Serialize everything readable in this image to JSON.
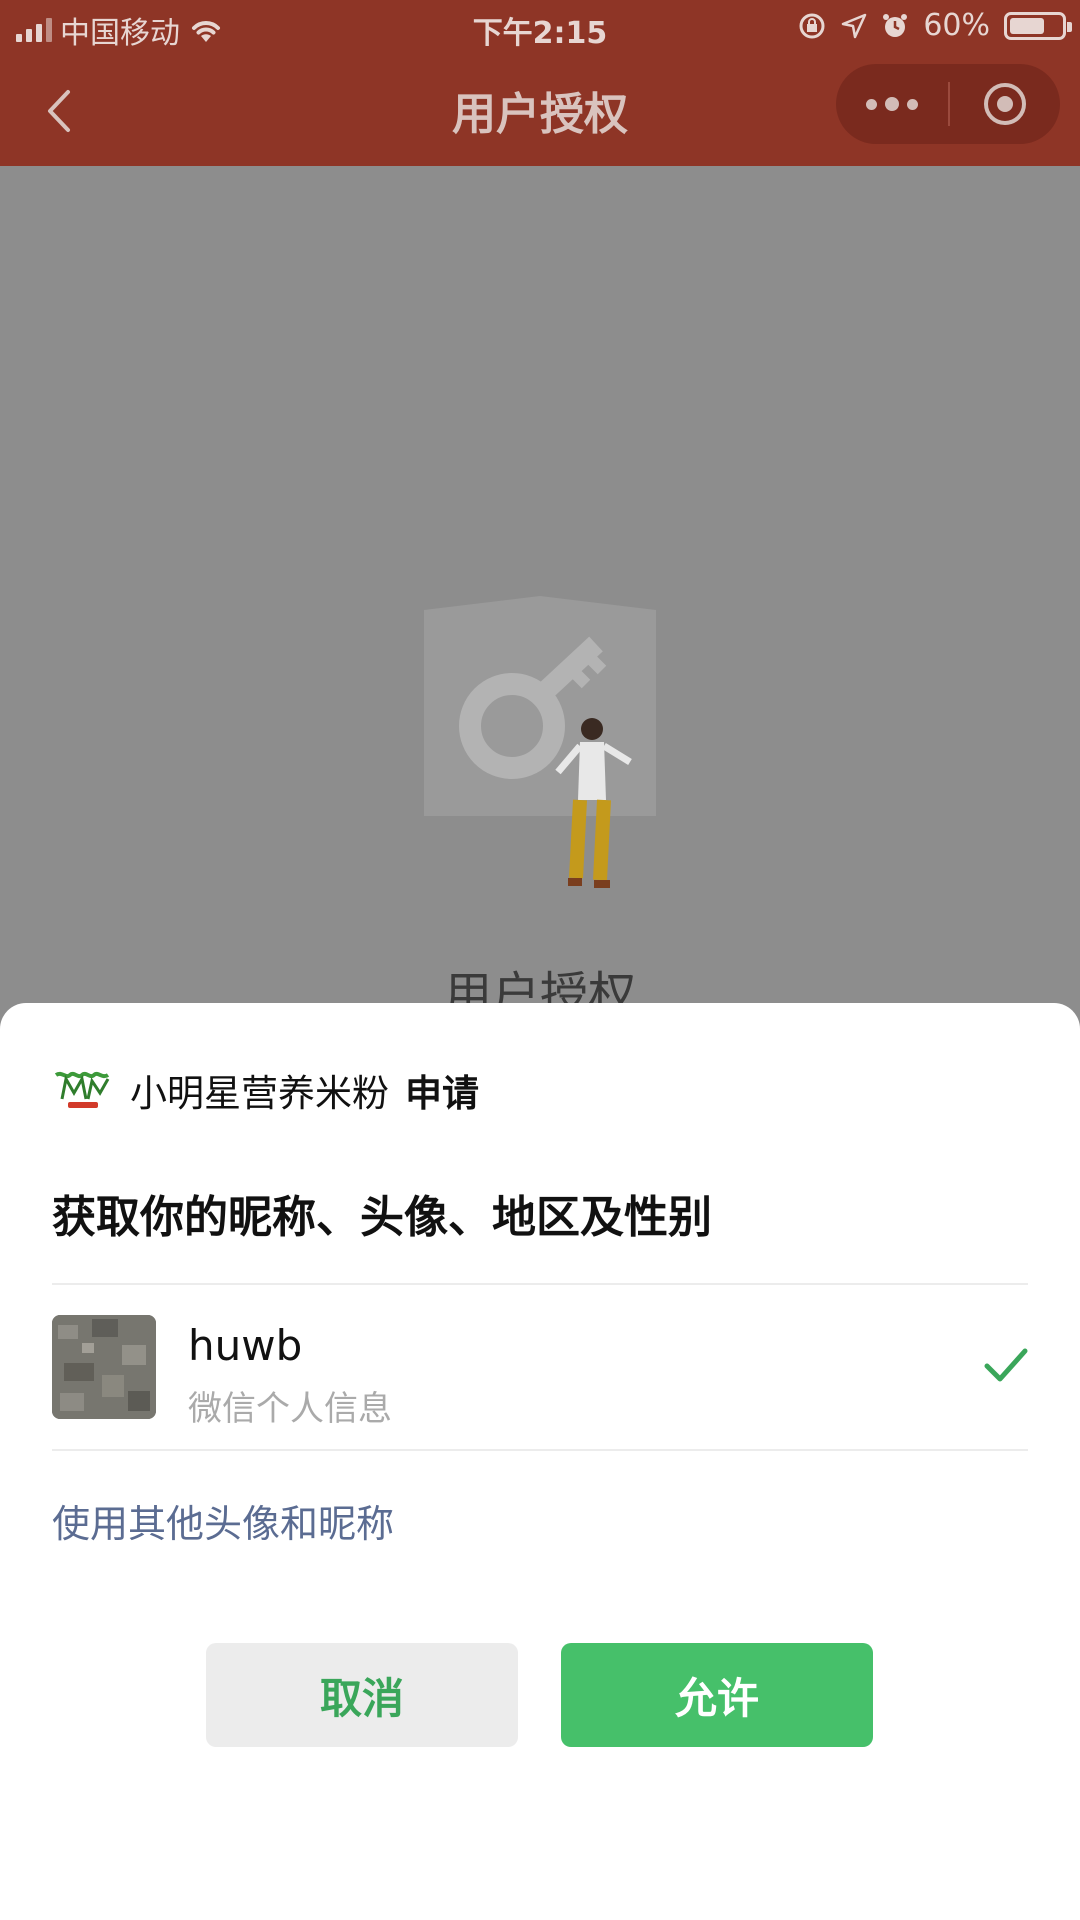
{
  "status_bar": {
    "carrier": "中国移动",
    "time": "下午2:15",
    "battery": "60%",
    "icons": [
      "signal-icon",
      "wifi-icon",
      "rotation-lock-icon",
      "location-icon",
      "alarm-icon",
      "battery-icon"
    ]
  },
  "nav": {
    "title": "用户授权",
    "icons": [
      "back-icon",
      "more-icon",
      "close-target-icon"
    ]
  },
  "background_page": {
    "title": "用户授权",
    "illustration": "key-person-illustration"
  },
  "sheet": {
    "app_name": "小明星营养米粉",
    "apply_label": "申请",
    "request_text": "获取你的昵称、头像、地区及性别",
    "account": {
      "nickname": "huwb",
      "subtitle": "微信个人信息",
      "selected": true
    },
    "other_link": "使用其他头像和昵称",
    "cancel_label": "取消",
    "allow_label": "允许"
  },
  "colors": {
    "nav_bg": "#8e3526",
    "allow_green": "#46c06a",
    "cancel_text_green": "#3aa65a",
    "link_blue": "#5b6c92"
  }
}
